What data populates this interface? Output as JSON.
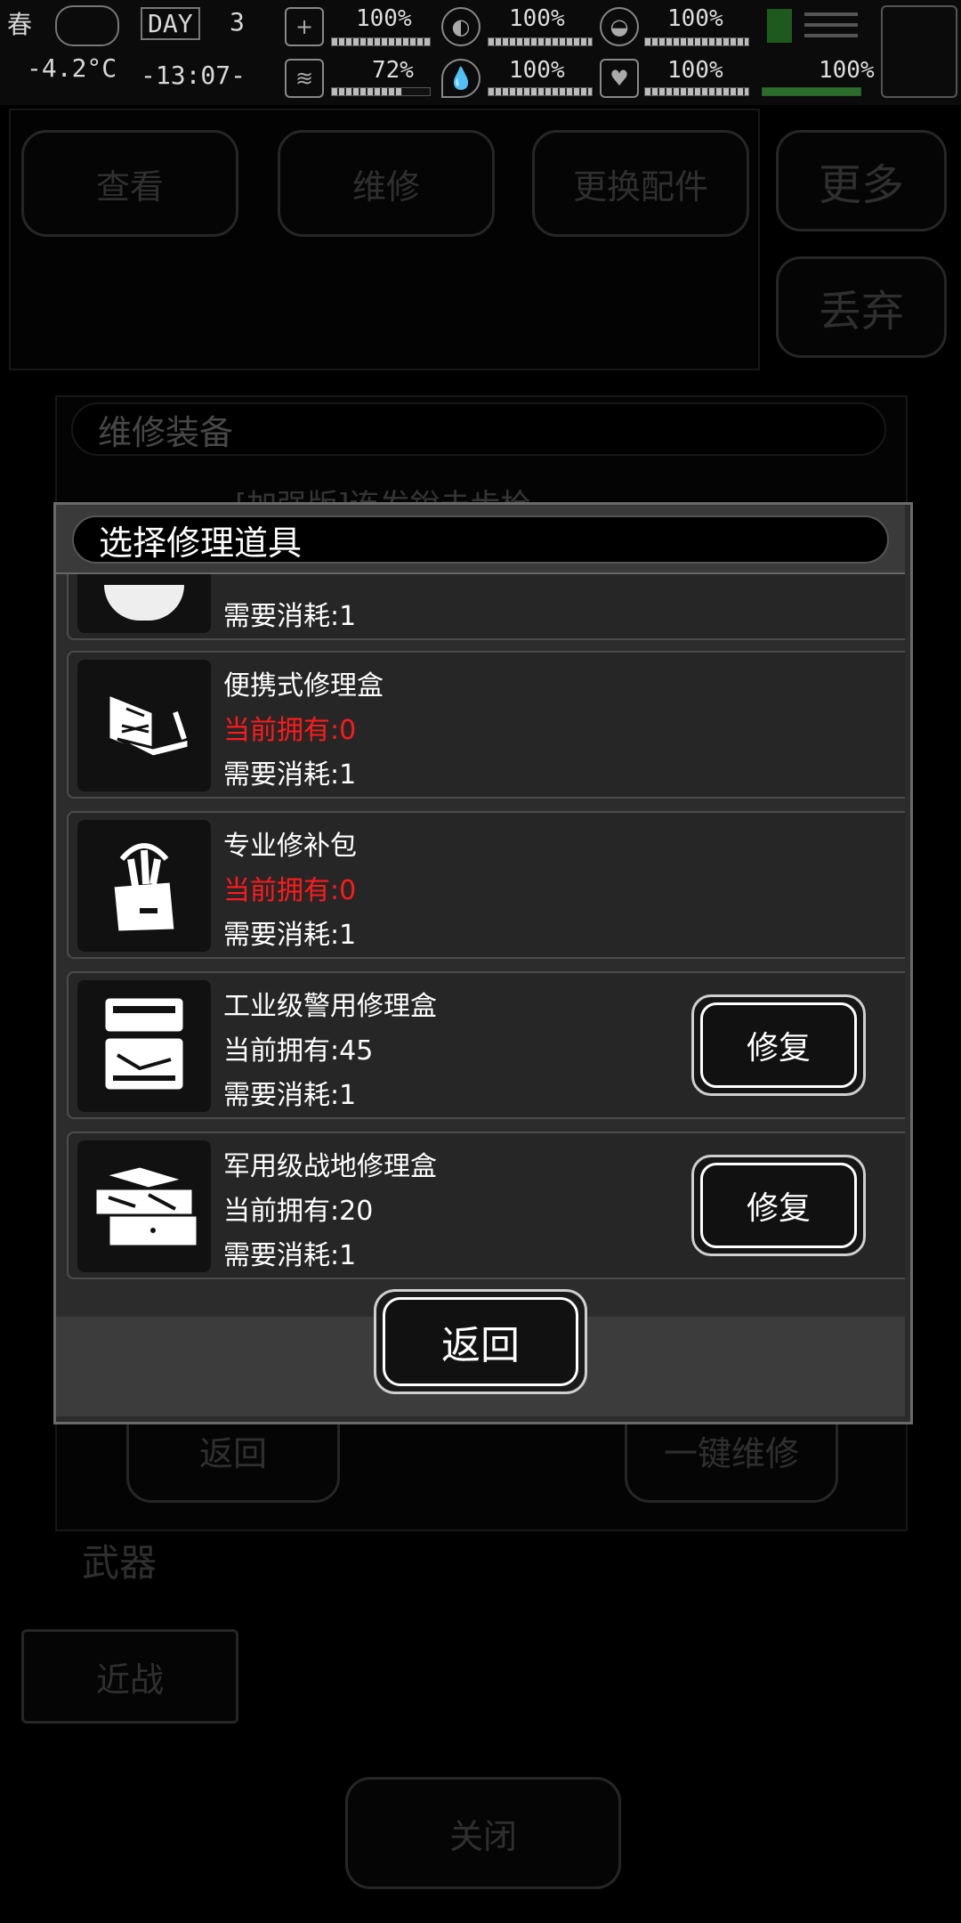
{
  "status_bar": {
    "season": "春",
    "day_label": "DAY",
    "day_value": "3",
    "temperature": "-4.2°C",
    "clock": "-13:07-",
    "stats_row1": [
      "100%",
      "100%",
      "100%",
      ""
    ],
    "stats_row2": [
      "72%",
      "100%",
      "100%",
      "100%"
    ],
    "stat_fill_row1": [
      1.0,
      1.0,
      1.0,
      1.0
    ],
    "stat_fill_row2": [
      0.72,
      1.0,
      1.0,
      1.0
    ]
  },
  "background": {
    "top_buttons": [
      "查看",
      "维修",
      "更换配件"
    ],
    "more_label": "更多",
    "discard_label": "丢弃",
    "repair_dialog_title": "维修装备",
    "partial_item_text": "[加强版]连发銳击步枪",
    "back_label": "返回",
    "one_key_repair_label": "一键维修",
    "weapon_label": "武器",
    "melee_label": "近战",
    "close_label": "关闭"
  },
  "dialog": {
    "title": "选择修理道具",
    "partial_item": {
      "cost": "需要消耗:1"
    },
    "items": [
      {
        "name": "便携式修理盒",
        "owned": "当前拥有:0",
        "cost": "需要消耗:1",
        "has_button": false,
        "icon": "portable-repair-box-icon"
      },
      {
        "name": "专业修补包",
        "owned": "当前拥有:0",
        "cost": "需要消耗:1",
        "has_button": false,
        "icon": "pro-repair-bag-icon"
      },
      {
        "name": "工业级警用修理盒",
        "owned": "当前拥有:45",
        "cost": "需要消耗:1",
        "has_button": true,
        "button_label": "修复",
        "icon": "police-repair-case-icon"
      },
      {
        "name": "军用级战地修理盒",
        "owned": "当前拥有:20",
        "cost": "需要消耗:1",
        "has_button": true,
        "button_label": "修复",
        "icon": "military-toolbox-icon"
      }
    ],
    "back_label": "返回"
  },
  "colors": {
    "zero_owned": "#ff1a1a",
    "panel_bg": "#2b2b2b"
  }
}
